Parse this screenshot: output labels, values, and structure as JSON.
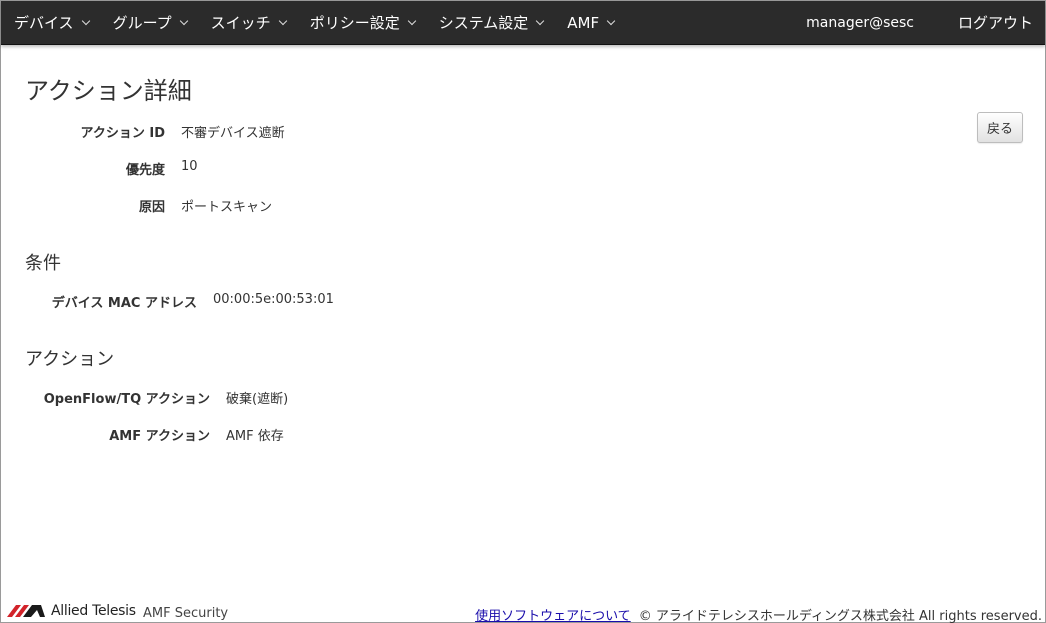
{
  "nav": {
    "items": [
      {
        "label": "デバイス"
      },
      {
        "label": "グループ"
      },
      {
        "label": "スイッチ"
      },
      {
        "label": "ポリシー設定"
      },
      {
        "label": "システム設定"
      },
      {
        "label": "AMF"
      }
    ],
    "user": "manager@sesc",
    "logout": "ログアウト"
  },
  "page": {
    "title": "アクション詳細",
    "back_label": "戻る"
  },
  "details": {
    "action_id_label": "アクション ID",
    "action_id_value": "不審デバイス遮断",
    "priority_label": "優先度",
    "priority_value": "10",
    "cause_label": "原因",
    "cause_value": "ポートスキャン"
  },
  "conditions": {
    "heading": "条件",
    "mac_label": "デバイス MAC アドレス",
    "mac_value": "00:00:5e:00:53:01"
  },
  "actions": {
    "heading": "アクション",
    "openflow_label": "OpenFlow/TQ アクション",
    "openflow_value": "破棄(遮断)",
    "amf_label": "AMF アクション",
    "amf_value": "AMF 依存"
  },
  "footer": {
    "logo_text": "Allied Telesis",
    "logo_icon": "allied-telesis-logo-icon",
    "product": "AMF Security",
    "link": "使用ソフトウェアについて",
    "copyright": "© アライドテレシスホールディングス株式会社 All rights reserved."
  },
  "colors": {
    "navbar": "#2b2b2b",
    "logo_red": "#d2232a",
    "link": "#1a0dab"
  }
}
